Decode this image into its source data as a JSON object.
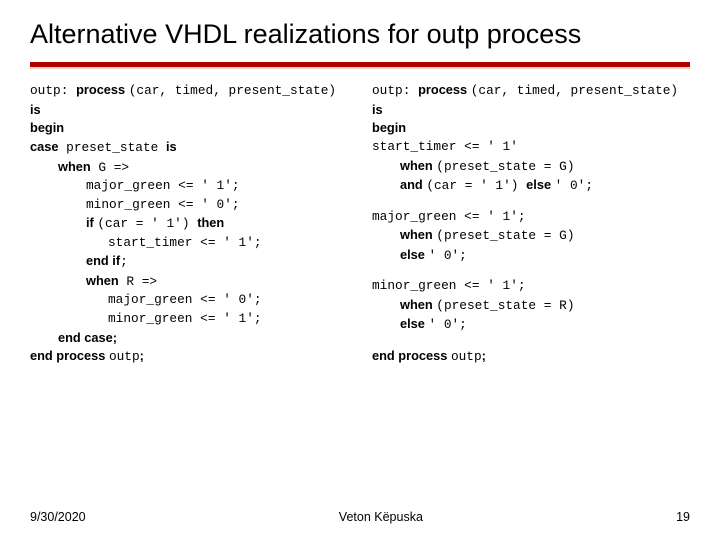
{
  "title": "Alternative VHDL realizations for outp process",
  "left": {
    "l1a": "outp: ",
    "l1b": "process ",
    "l1c": "(car, timed, present_state) ",
    "l1d": "is",
    "l2": "begin",
    "l3a": "case",
    "l3b": " preset_state ",
    "l3c": "is",
    "l4a": "when",
    "l4b": " G =>",
    "l5": "major_green <= ' 1';",
    "l6": "minor_green <= ' 0';",
    "l7a": "if ",
    "l7b": "(car = ' 1') ",
    "l7c": "then",
    "l8": "start_timer <= ' 1';",
    "l9a": "end if",
    "l9b": ";",
    "l10a": "when",
    "l10b": " R =>",
    "l11": "major_green <= ' 0';",
    "l12": "minor_green <= ' 1';",
    "l13": "end case;",
    "l14a": "end process ",
    "l14b": "outp",
    "l14c": ";"
  },
  "right": {
    "l1a": "outp: ",
    "l1b": "process ",
    "l1c": "(car, timed, present_state) ",
    "l1d": "is",
    "l2": "begin",
    "l3a": "start_timer <= ' 1'",
    "l4a": "when ",
    "l4b": "(preset_state = G)",
    "l5a": "and ",
    "l5b": "(car = ' 1') ",
    "l5c": "else ",
    "l5d": "' 0';",
    "l6": "major_green <= ' 1';",
    "l7a": "when ",
    "l7b": "(preset_state = G)",
    "l8a": "else ",
    "l8b": "' 0';",
    "l9": "minor_green <= ' 1';",
    "l10a": "when ",
    "l10b": "(preset_state = R)",
    "l11a": "else ",
    "l11b": "' 0';",
    "l12a": "end process ",
    "l12b": "outp",
    "l12c": ";"
  },
  "footer": {
    "date": "9/30/2020",
    "author": "Veton Këpuska",
    "page": "19"
  }
}
